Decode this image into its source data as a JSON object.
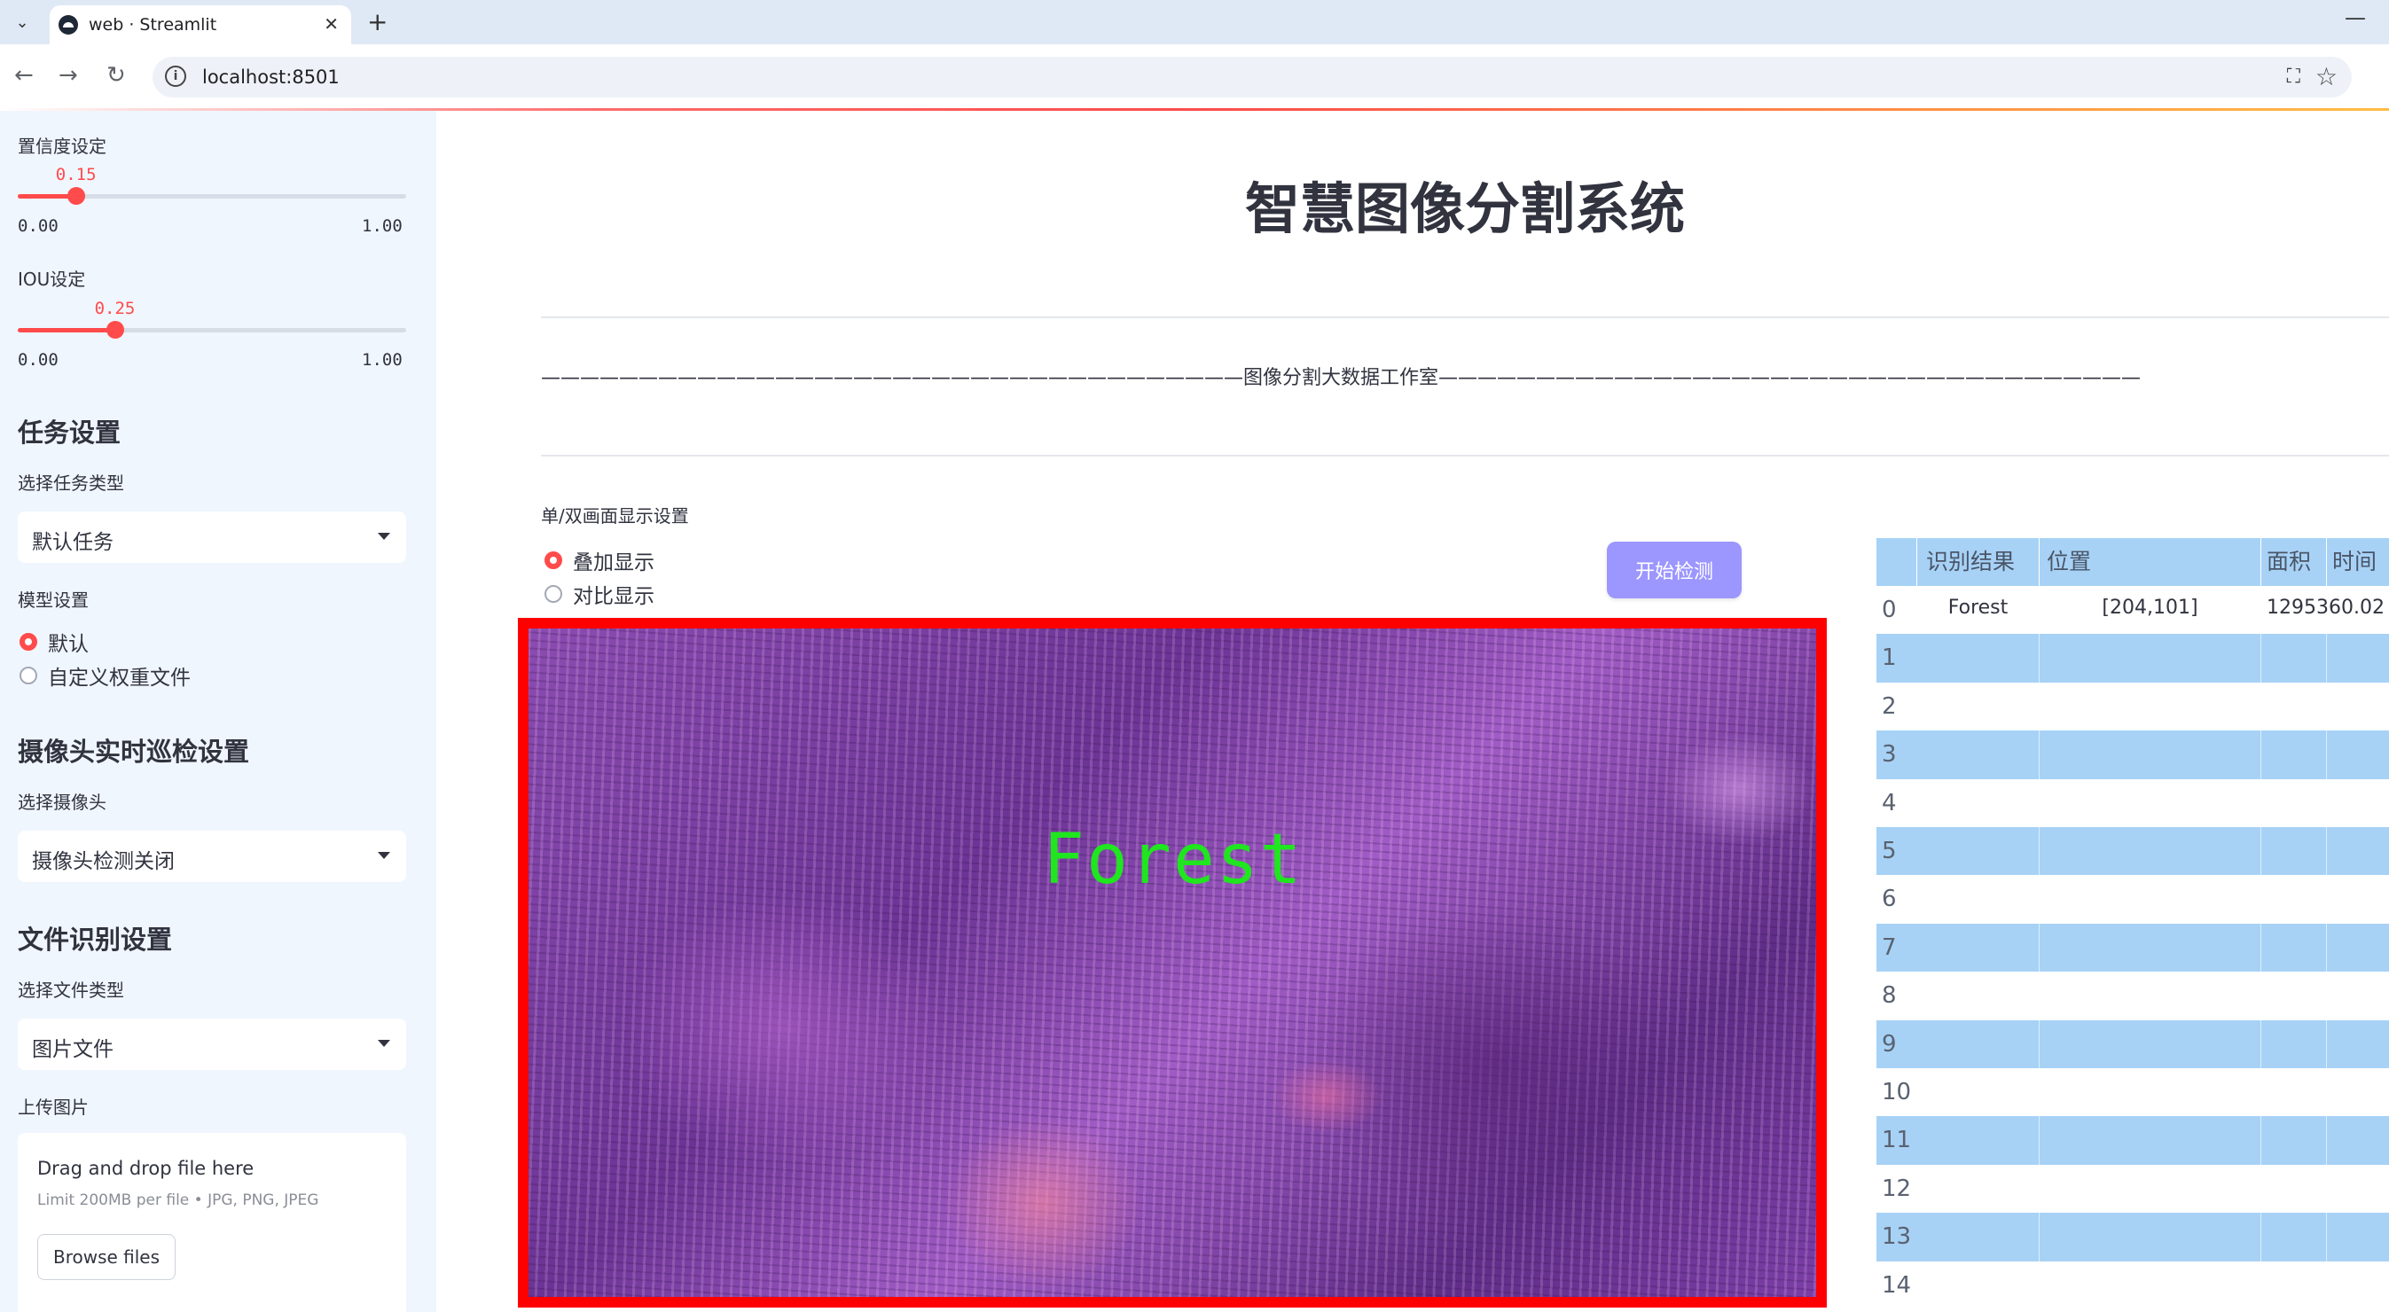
{
  "browser": {
    "tab_title": "web · Streamlit",
    "url": "localhost:8501"
  },
  "sidebar": {
    "confidence": {
      "label": "置信度设定",
      "value": 0.15,
      "value_text": "0.15",
      "min": "0.00",
      "max": "1.00"
    },
    "iou": {
      "label": "IOU设定",
      "value": 0.25,
      "value_text": "0.25",
      "min": "0.00",
      "max": "1.00"
    },
    "task_heading": "任务设置",
    "task_type_label": "选择任务类型",
    "task_type_value": "默认任务",
    "model_label": "模型设置",
    "model_options": [
      "默认",
      "自定义权重文件"
    ],
    "camera_heading": "摄像头实时巡检设置",
    "camera_label": "选择摄像头",
    "camera_value": "摄像头检测关闭",
    "file_heading": "文件识别设置",
    "file_type_label": "选择文件类型",
    "file_type_value": "图片文件",
    "upload_label": "上传图片",
    "upload_title": "Drag and drop file here",
    "upload_limit": "Limit 200MB per file • JPG, PNG, JPEG",
    "browse_label": "Browse files"
  },
  "main": {
    "title": "智慧图像分割系统",
    "banner": "————————————————————————————————————图像分割大数据工作室————————————————————————————————————",
    "display_mode_label": "单/双画面显示设置",
    "display_options": [
      "叠加显示",
      "对比显示"
    ],
    "start_button": "开始检测",
    "overlay_label": "Forest"
  },
  "table": {
    "headers": [
      "识别结果",
      "位置",
      "面积",
      "时间"
    ],
    "row_indices": [
      "0",
      "1",
      "2",
      "3",
      "4",
      "5",
      "6",
      "7",
      "8",
      "9",
      "10",
      "11",
      "12",
      "13",
      "14"
    ],
    "rows": [
      {
        "result": "Forest",
        "position": "[204,101]",
        "area": "1295360.02",
        "time": ""
      }
    ]
  }
}
